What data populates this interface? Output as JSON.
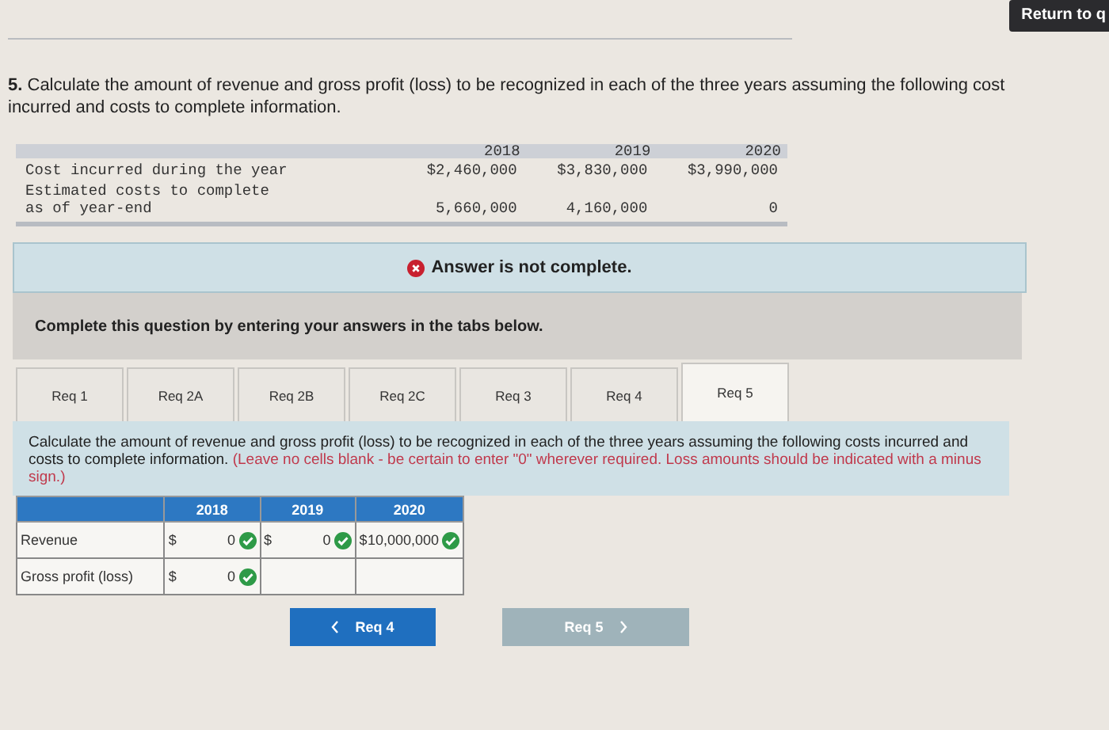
{
  "return_button": "Return to q",
  "question": {
    "number": "5.",
    "text": "Calculate the amount of revenue and gross profit (loss) to be recognized in each of the three years assuming the following cost\nincurred and costs to complete information."
  },
  "data_table": {
    "columns": [
      "2018",
      "2019",
      "2020"
    ],
    "rows": [
      {
        "label": "Cost incurred during the year",
        "values": [
          "$2,460,000",
          "$3,830,000",
          "$3,990,000"
        ]
      },
      {
        "label": "Estimated costs to complete as of year-end",
        "values": [
          "5,660,000",
          "4,160,000",
          "0"
        ]
      }
    ]
  },
  "alert": {
    "kind": "error",
    "text": "Answer is not complete."
  },
  "prompt": "Complete this question by entering your answers in the tabs below.",
  "tabs": [
    {
      "label": "Req 1",
      "selected": false
    },
    {
      "label": "Req 2A",
      "selected": false
    },
    {
      "label": "Req 2B",
      "selected": false
    },
    {
      "label": "Req 2C",
      "selected": false
    },
    {
      "label": "Req 3",
      "selected": false
    },
    {
      "label": "Req 4",
      "selected": false
    },
    {
      "label": "Req 5",
      "selected": true
    }
  ],
  "instructions": {
    "text": "Calculate the amount of revenue and gross profit (loss) to be recognized in each of the three years assuming the following costs incurred and costs to complete information.",
    "note": "(Leave no cells blank - be certain to enter \"0\" wherever required. Loss amounts should be indicated with a minus sign.)"
  },
  "answer_table": {
    "columns": [
      "2018",
      "2019",
      "2020"
    ],
    "rows": [
      {
        "label": "Revenue",
        "cells": [
          {
            "prefix": "$",
            "value": "0",
            "correct": true
          },
          {
            "prefix": "$",
            "value": "0",
            "correct": true
          },
          {
            "prefix": "$",
            "value": "10,000,000",
            "correct": true
          }
        ]
      },
      {
        "label": "Gross profit (loss)",
        "cells": [
          {
            "prefix": "$",
            "value": "0",
            "correct": true
          },
          null,
          null
        ]
      }
    ]
  },
  "nav": [
    {
      "label": "Req 4",
      "kind": "previous",
      "disabled": false
    },
    {
      "label": "Req 5",
      "kind": "next",
      "disabled": true
    }
  ]
}
